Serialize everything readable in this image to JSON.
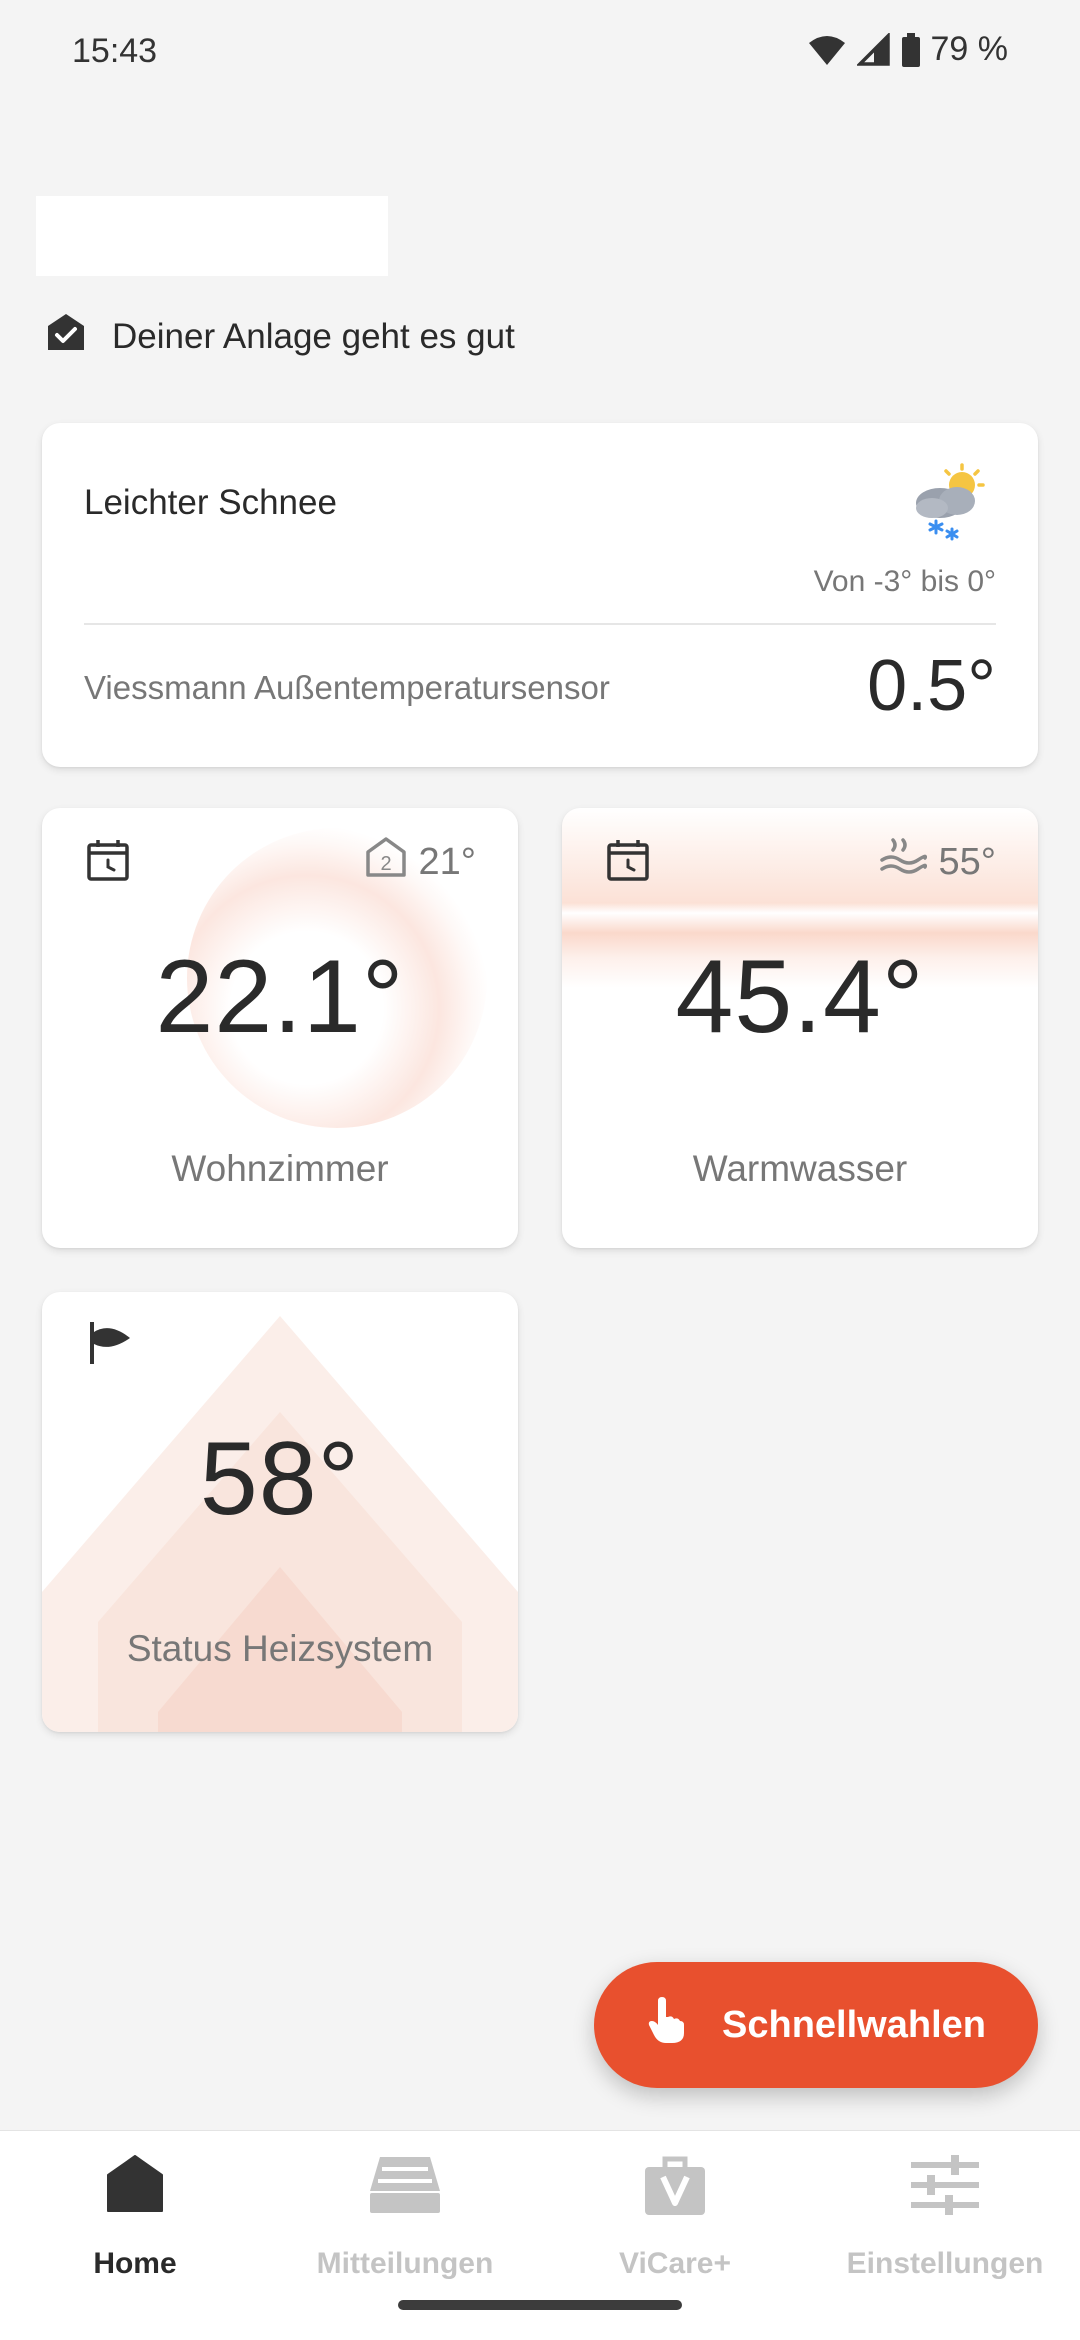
{
  "status_bar": {
    "time": "15:43",
    "battery": "79 %",
    "icons": [
      "wifi-icon",
      "signal-icon",
      "battery-icon"
    ]
  },
  "system_status": {
    "text": "Deiner Anlage geht es gut",
    "icon": "house-check-icon"
  },
  "weather": {
    "condition": "Leichter Schnee",
    "range": "Von -3° bis 0°",
    "icon": "snow-cloud-sun-icon",
    "sensor_name": "Viessmann Außentemperatursensor",
    "sensor_value": "0.5°"
  },
  "tiles": {
    "room": {
      "label": "Wohnzimmer",
      "value": "22.1°",
      "target": "21°",
      "icons": [
        "calendar-clock-icon",
        "house-program-icon"
      ]
    },
    "water": {
      "label": "Warmwasser",
      "value": "45.4°",
      "target": "55°",
      "icons": [
        "calendar-clock-icon",
        "steam-icon"
      ]
    },
    "heating": {
      "label": "Status Heizsystem",
      "value": "58°",
      "icons": [
        "flame-flag-icon"
      ]
    }
  },
  "fab": {
    "label": "Schnellwahlen",
    "icon": "hand-pointer-icon"
  },
  "nav": {
    "items": [
      {
        "label": "Home",
        "icon": "home-icon",
        "active": true
      },
      {
        "label": "Mitteilungen",
        "icon": "inbox-icon",
        "active": false
      },
      {
        "label": "ViCare+",
        "icon": "bag-icon",
        "active": false
      },
      {
        "label": "Einstellungen",
        "icon": "sliders-icon",
        "active": false
      }
    ]
  },
  "colors": {
    "accent": "#e8502e",
    "background": "#f4f4f4",
    "text_primary": "#2a2a2a",
    "text_secondary": "#777777",
    "nav_inactive": "#c4c4c4"
  }
}
